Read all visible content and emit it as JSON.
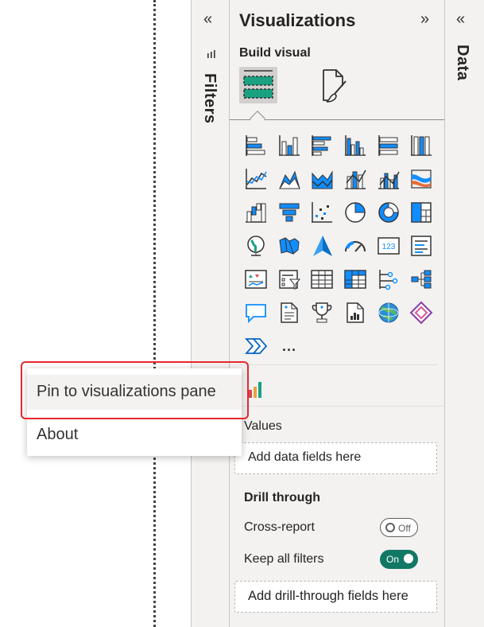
{
  "filters_pane": {
    "collapse_glyph": "«",
    "label": "Filters"
  },
  "visualizations_pane": {
    "title": "Visualizations",
    "expand_glyph": "»",
    "build_visual_label": "Build visual",
    "more_glyph": "...",
    "values_label": "Values",
    "values_placeholder": "Add data fields here",
    "drill_through_label": "Drill through",
    "cross_report_label": "Cross-report",
    "cross_report_toggle": "Off",
    "keep_filters_label": "Keep all filters",
    "keep_filters_toggle": "On",
    "drill_placeholder": "Add drill-through fields here",
    "icons": [
      [
        "stacked-bar-chart-icon",
        "stacked-column-chart-icon",
        "clustered-bar-chart-icon",
        "clustered-column-chart-icon",
        "100-stacked-bar-chart-icon",
        "100-stacked-column-chart-icon"
      ],
      [
        "line-chart-icon",
        "area-chart-icon",
        "stacked-area-chart-icon",
        "line-and-stacked-column-icon",
        "line-and-clustered-column-icon",
        "ribbon-chart-icon"
      ],
      [
        "waterfall-chart-icon",
        "funnel-icon",
        "scatter-chart-icon",
        "pie-chart-icon",
        "donut-chart-icon",
        "treemap-icon"
      ],
      [
        "map-icon",
        "filled-map-icon",
        "azure-map-icon",
        "gauge-icon",
        "card-icon",
        "multi-row-card-icon"
      ],
      [
        "kpi-icon",
        "slicer-icon",
        "table-icon",
        "matrix-icon",
        "key-influencers-icon",
        "decomposition-tree-icon"
      ],
      [
        "qna-icon",
        "smart-narrative-icon",
        "metrics-icon",
        "paginated-report-icon",
        "arcgis-map-icon",
        "power-apps-icon"
      ],
      [
        "power-automate-icon",
        "more-visuals-icon"
      ]
    ],
    "custom_visual_icon": "custom-visual-icon"
  },
  "data_pane": {
    "collapse_glyph": "«",
    "label": "Data"
  },
  "context_menu": {
    "pin_label": "Pin to visualizations pane",
    "about_label": "About"
  },
  "colors": {
    "accent_blue": "#118dff",
    "toggle_on": "#117865",
    "highlight_red": "#e8272e",
    "pane_bg": "#f3f2f1"
  }
}
